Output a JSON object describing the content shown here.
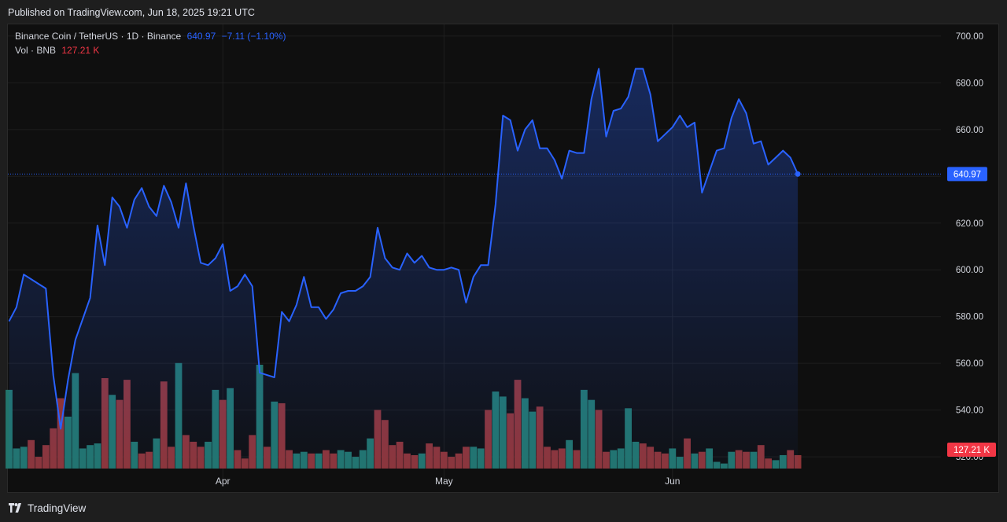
{
  "header": {
    "published": "Published on TradingView.com, Jun 18, 2025 19:21 UTC"
  },
  "legend": {
    "symbol": "Binance Coin / TetherUS · 1D · Binance",
    "price": "640.97",
    "change": "−7.11 (−1.10%)",
    "volume_label": "Vol · BNB",
    "volume_value": "127.21 K"
  },
  "footer": {
    "brand": "TradingView"
  },
  "colors": {
    "line": "#2962ff",
    "up_volume": "#22756c",
    "down_volume": "#8e3437",
    "price_badge": "#2962ff",
    "volume_badge": "#f23645"
  },
  "chart_data": {
    "type": "line",
    "title": "Binance Coin / TetherUS · 1D · Binance",
    "xlabel": "",
    "ylabel": "",
    "ylim": [
      515,
      705
    ],
    "y_ticks": [
      520,
      540,
      560,
      580,
      600,
      620,
      640,
      660,
      680,
      700
    ],
    "y_tick_labels": [
      "520.00",
      "540.00",
      "560.00",
      "580.00",
      "600.00",
      "620.00",
      "640.00",
      "660.00",
      "680.00",
      "700.00"
    ],
    "x_ticks": [
      {
        "index": 29,
        "label": "Apr"
      },
      {
        "index": 59,
        "label": "May"
      },
      {
        "index": 90,
        "label": "Jun"
      }
    ],
    "last_price_label": "640.97",
    "last_volume_label": "127.21 K",
    "series": [
      {
        "values": [
          578,
          584,
          598,
          596,
          594,
          592,
          555,
          532,
          553,
          570,
          579,
          588,
          619,
          602,
          631,
          627,
          618,
          630,
          635,
          627,
          623,
          636,
          629,
          618,
          637,
          619,
          603,
          602,
          605,
          611,
          591,
          593,
          598,
          593,
          556,
          555,
          554,
          582,
          578,
          585,
          597,
          584,
          584,
          579,
          583,
          590,
          591,
          591,
          593,
          597,
          618,
          605,
          601,
          600,
          607,
          603,
          606,
          601,
          600,
          600,
          601,
          600,
          586,
          597,
          602,
          602,
          628,
          666,
          664,
          651,
          660,
          664,
          652,
          652,
          647,
          639,
          651,
          650,
          650,
          673,
          686,
          657,
          668,
          669,
          674,
          686,
          686,
          675,
          655,
          658,
          661,
          666,
          661,
          663,
          633,
          642,
          651,
          652,
          665,
          673,
          667,
          654,
          655,
          645,
          648,
          651,
          648,
          641
        ]
      },
      {
        "name": "Vol · BNB",
        "values": [
          47,
          12,
          13,
          17,
          7,
          14,
          24,
          42,
          31,
          57,
          12,
          14,
          15,
          54,
          44,
          41,
          53,
          16,
          9,
          10,
          18,
          52,
          13,
          63,
          20,
          16,
          13,
          16,
          47,
          41,
          48,
          11,
          6,
          20,
          62,
          13,
          40,
          39,
          11,
          9,
          10,
          9,
          9,
          11,
          9,
          11,
          10,
          7,
          11,
          18,
          35,
          29,
          14,
          16,
          9,
          8,
          9,
          15,
          13,
          10,
          7,
          9,
          13,
          13,
          12,
          35,
          46,
          43,
          33,
          53,
          42,
          34,
          37,
          13,
          11,
          12,
          17,
          11,
          47,
          41,
          35,
          10,
          11,
          12,
          36,
          16,
          15,
          13,
          10,
          9,
          12,
          7,
          18,
          9,
          10,
          12,
          4,
          3,
          10,
          11,
          10,
          10,
          14,
          6,
          5,
          8,
          11,
          8
        ],
        "direction": [
          "up",
          "up",
          "up",
          "down",
          "down",
          "down",
          "down",
          "down",
          "up",
          "up",
          "up",
          "up",
          "up",
          "down",
          "up",
          "down",
          "down",
          "up",
          "down",
          "down",
          "up",
          "down",
          "down",
          "up",
          "down",
          "down",
          "down",
          "up",
          "up",
          "down",
          "up",
          "down",
          "down",
          "down",
          "up",
          "down",
          "up",
          "down",
          "down",
          "up",
          "up",
          "down",
          "up",
          "down",
          "down",
          "up",
          "up",
          "up",
          "up",
          "up",
          "down",
          "down",
          "down",
          "down",
          "down",
          "down",
          "up",
          "down",
          "down",
          "down",
          "down",
          "down",
          "down",
          "up",
          "up",
          "down",
          "up",
          "up",
          "down",
          "down",
          "up",
          "up",
          "down",
          "down",
          "down",
          "down",
          "up",
          "down",
          "up",
          "up",
          "down",
          "down",
          "up",
          "up",
          "up",
          "up",
          "down",
          "down",
          "down",
          "down",
          "up",
          "up",
          "down",
          "up",
          "down",
          "up",
          "up",
          "up",
          "up",
          "down",
          "down",
          "up",
          "down",
          "down",
          "up",
          "up",
          "down",
          "down"
        ]
      }
    ]
  }
}
